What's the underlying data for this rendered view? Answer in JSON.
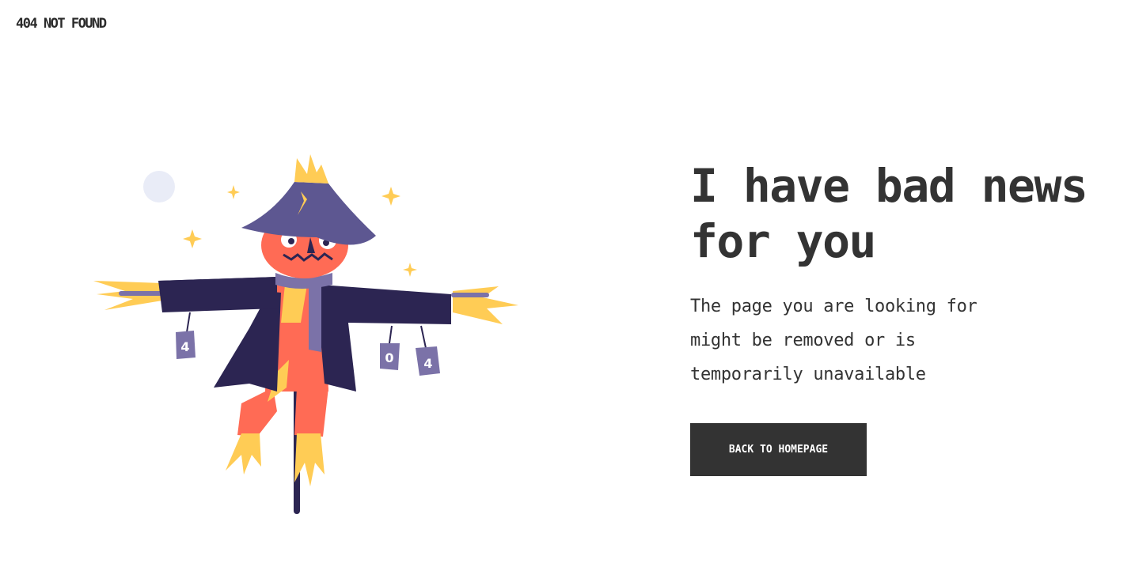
{
  "header": {
    "brand": "404 NOT FOUND"
  },
  "main": {
    "headline": "I have bad news for you",
    "description": "The page you are looking for might be removed or is temporarily unavailable",
    "cta_label": "BACK TO HOMEPAGE"
  },
  "illustration": {
    "can_labels": [
      "4",
      "0",
      "4"
    ]
  },
  "colors": {
    "text": "#333333",
    "button_bg": "#333333",
    "button_text": "#ffffff",
    "hat": "#5d5791",
    "coat": "#2c2552",
    "face": "#ff6b55",
    "straw": "#ffcc55",
    "can": "#7b72a8",
    "moon": "#e9ecf7"
  }
}
